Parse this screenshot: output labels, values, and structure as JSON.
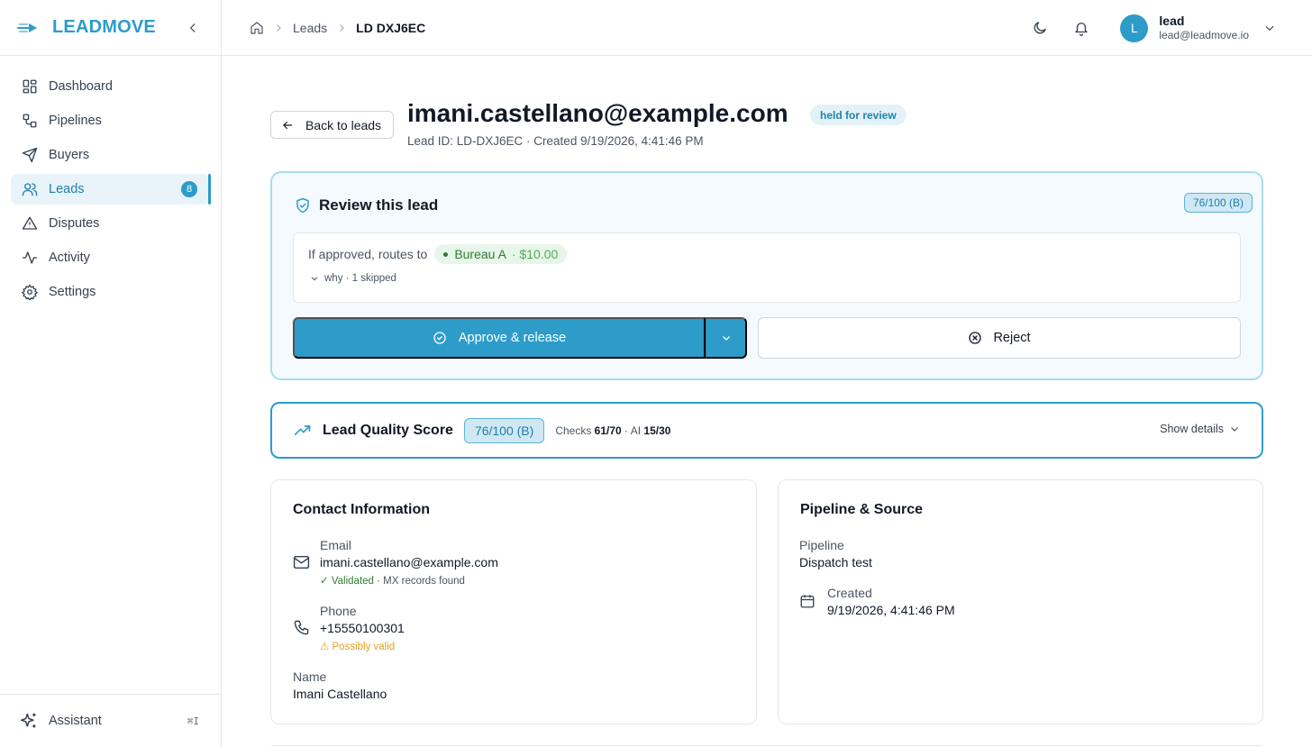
{
  "brand": {
    "name": "LEADMOVE"
  },
  "nav": {
    "items": [
      {
        "label": "Dashboard"
      },
      {
        "label": "Pipelines"
      },
      {
        "label": "Buyers"
      },
      {
        "label": "Leads",
        "badge": "8"
      },
      {
        "label": "Disputes"
      },
      {
        "label": "Activity"
      },
      {
        "label": "Settings"
      }
    ],
    "assistant": {
      "label": "Assistant",
      "shortcut": "⌘I"
    }
  },
  "breadcrumb": {
    "items": [
      "Leads",
      "LD DXJ6EC"
    ]
  },
  "user": {
    "initial": "L",
    "name": "lead",
    "email": "lead@leadmove.io"
  },
  "page": {
    "back_label": "Back to leads",
    "title": "imani.castellano@example.com",
    "status": "held for review",
    "subtitle": "Lead ID: LD-DXJ6EC · Created 9/19/2026, 4:41:46 PM"
  },
  "review": {
    "title": "Review this lead",
    "score": "76/100 (B)",
    "routes_label": "If approved, routes to",
    "buyer": "Bureau A",
    "price": "· $10.00",
    "why": "why · 1 skipped",
    "approve_label": "Approve & release",
    "reject_label": "Reject"
  },
  "quality": {
    "title": "Lead Quality Score",
    "score": "76/100 (B)",
    "checks_label": "Checks",
    "checks_value": "61/70",
    "ai_label": "· AI",
    "ai_value": "15/30",
    "details_label": "Show details"
  },
  "contact": {
    "title": "Contact Information",
    "email_label": "Email",
    "email_value": "imani.castellano@example.com",
    "email_ok": "✓ Validated",
    "email_note": "· MX records found",
    "phone_label": "Phone",
    "phone_value": "+15550100301",
    "phone_warn": "⚠ Possibly valid",
    "name_label": "Name",
    "name_value": "Imani Castellano"
  },
  "pipeline": {
    "title": "Pipeline & Source",
    "pipeline_label": "Pipeline",
    "pipeline_value": "Dispatch test",
    "created_label": "Created",
    "created_value": "9/19/2026, 4:41:46 PM"
  },
  "colors": {
    "accent": "#2d9cc9",
    "success": "#2e7d32",
    "warning": "#e0a11b"
  }
}
